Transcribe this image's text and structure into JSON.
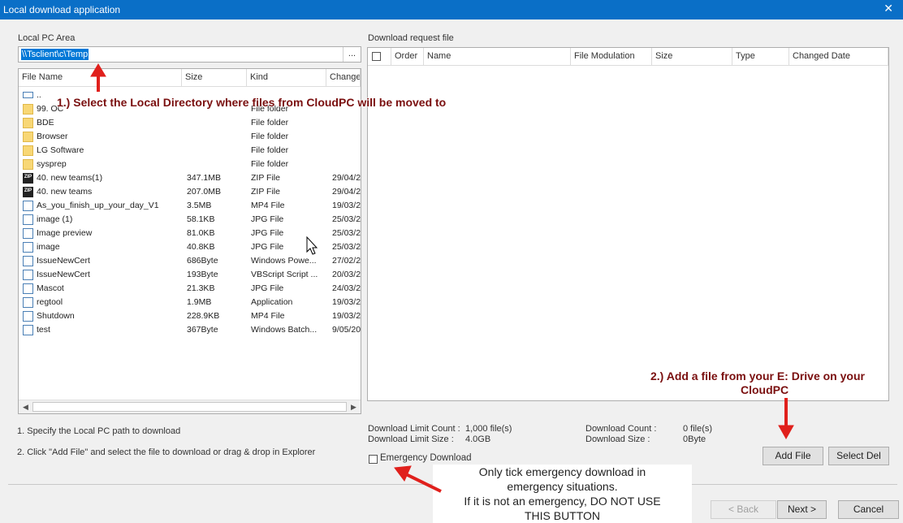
{
  "window": {
    "title": "Local download application",
    "close": "✕"
  },
  "local": {
    "label": "Local PC Area",
    "path": "\\\\Tsclient\\c\\Temp",
    "browse": "...",
    "columns": [
      "File Name",
      "Size",
      "Kind",
      "Change"
    ],
    "rows": [
      {
        "icon": "drive",
        "name": "..",
        "size": "",
        "kind": "",
        "date": ""
      },
      {
        "icon": "folder",
        "name": "99. OC",
        "size": "",
        "kind": "File folder",
        "date": ""
      },
      {
        "icon": "folder",
        "name": "BDE",
        "size": "",
        "kind": "File folder",
        "date": ""
      },
      {
        "icon": "folder",
        "name": "Browser",
        "size": "",
        "kind": "File folder",
        "date": ""
      },
      {
        "icon": "folder",
        "name": "LG Software",
        "size": "",
        "kind": "File folder",
        "date": ""
      },
      {
        "icon": "folder",
        "name": "sysprep",
        "size": "",
        "kind": "File folder",
        "date": ""
      },
      {
        "icon": "zip",
        "name": "40. new teams(1)",
        "size": "347.1MB",
        "kind": "ZIP File",
        "date": "29/04/2"
      },
      {
        "icon": "zip",
        "name": "40. new teams",
        "size": "207.0MB",
        "kind": "ZIP File",
        "date": "29/04/2"
      },
      {
        "icon": "doc",
        "name": "As_you_finish_up_your_day_V1",
        "size": "3.5MB",
        "kind": "MP4 File",
        "date": "19/03/2"
      },
      {
        "icon": "doc",
        "name": "image (1)",
        "size": "58.1KB",
        "kind": "JPG File",
        "date": "25/03/2"
      },
      {
        "icon": "doc",
        "name": "Image preview",
        "size": "81.0KB",
        "kind": "JPG File",
        "date": "25/03/2"
      },
      {
        "icon": "doc",
        "name": "image",
        "size": "40.8KB",
        "kind": "JPG File",
        "date": "25/03/2"
      },
      {
        "icon": "doc",
        "name": "IssueNewCert",
        "size": "686Byte",
        "kind": "Windows Powe...",
        "date": "27/02/2"
      },
      {
        "icon": "doc",
        "name": "IssueNewCert",
        "size": "193Byte",
        "kind": "VBScript Script ...",
        "date": "20/03/2"
      },
      {
        "icon": "doc",
        "name": "Mascot",
        "size": "21.3KB",
        "kind": "JPG File",
        "date": "24/03/2"
      },
      {
        "icon": "doc",
        "name": "regtool",
        "size": "1.9MB",
        "kind": "Application",
        "date": "19/03/2"
      },
      {
        "icon": "doc",
        "name": "Shutdown",
        "size": "228.9KB",
        "kind": "MP4 File",
        "date": "19/03/2"
      },
      {
        "icon": "doc",
        "name": "test",
        "size": "367Byte",
        "kind": "Windows Batch...",
        "date": "9/05/20"
      }
    ]
  },
  "request": {
    "label": "Download request file",
    "columns": [
      "Order",
      "Name",
      "File Modulation",
      "Size",
      "Type",
      "Changed Date"
    ]
  },
  "instructions": {
    "step1": "1. Specify the Local PC path to download",
    "step2": "2. Click \"Add File\" and select the file to download or drag & drop in Explorer"
  },
  "limits": {
    "count_label": "Download Limit Count :",
    "count_value": "1,000 file(s)",
    "size_label": "Download Limit Size :",
    "size_value": "4.0GB",
    "dl_count_label": "Download Count :",
    "dl_count_value": "0 file(s)",
    "dl_size_label": "Download Size :",
    "dl_size_value": "0Byte"
  },
  "emergency": {
    "label": "Emergency Download"
  },
  "buttons": {
    "add_file": "Add File",
    "select_del": "Select Del",
    "back": "< Back",
    "next": "Next >",
    "cancel": "Cancel"
  },
  "annotations": {
    "a1": "1.) Select the Local Directory where files from CloudPC will be moved to",
    "a2_line1": "2.) Add a file from your E: Drive on your",
    "a2_line2": "CloudPC",
    "note_line1": "Only tick emergency download in",
    "note_line2": "emergency situations.",
    "note_line3": "If it is not an emergency, DO NOT USE",
    "note_line4": "THIS BUTTON"
  },
  "colors": {
    "titlebar": "#0a6fc7",
    "annotation": "#7a0f0f",
    "arrow": "#e0201c",
    "selection": "#0078d7"
  }
}
